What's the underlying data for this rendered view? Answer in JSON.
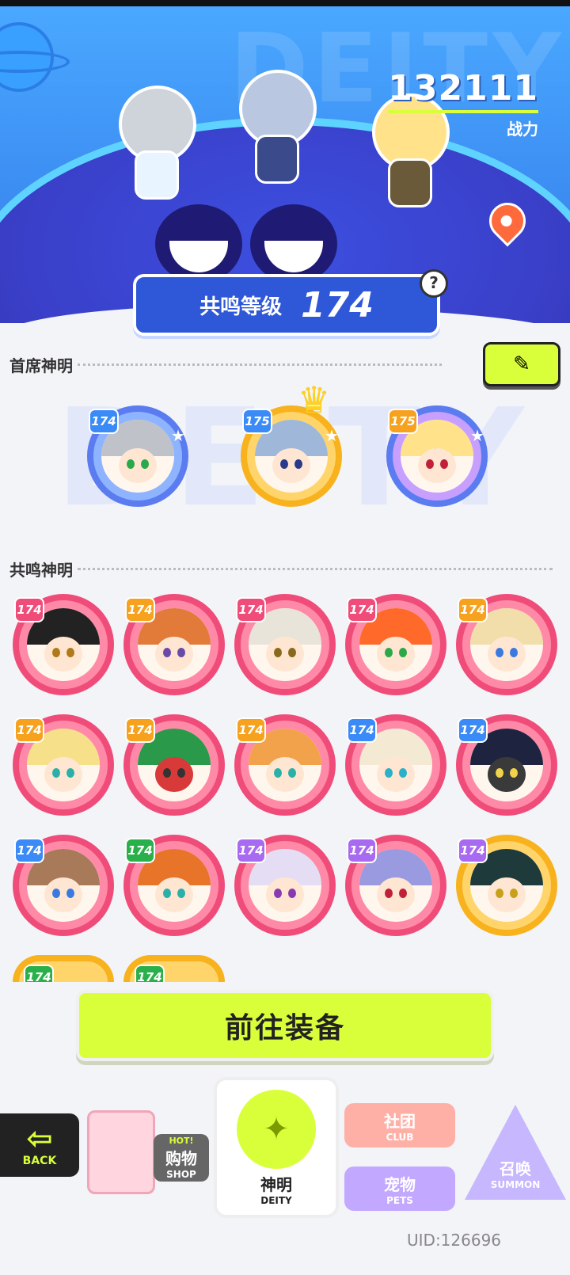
{
  "header": {
    "combat_power": "132111",
    "combat_power_label": "战力",
    "resonance_label": "共鸣等级",
    "resonance_level": "174",
    "help_icon": "?"
  },
  "sections": {
    "lead_title": "首席神明",
    "resonance_title": "共鸣神明"
  },
  "lead_deities": [
    {
      "level": "174",
      "frame": "purple"
    },
    {
      "level": "175",
      "frame": "gold"
    },
    {
      "level": "175",
      "frame": "purple"
    }
  ],
  "resonance_deities": [
    {
      "level": "174",
      "frame": "pink"
    },
    {
      "level": "174",
      "frame": "pink"
    },
    {
      "level": "174",
      "frame": "pink"
    },
    {
      "level": "174",
      "frame": "pink"
    },
    {
      "level": "174",
      "frame": "pink"
    },
    {
      "level": "174",
      "frame": "pink"
    },
    {
      "level": "174",
      "frame": "pink"
    },
    {
      "level": "174",
      "frame": "pink"
    },
    {
      "level": "174",
      "frame": "pink"
    },
    {
      "level": "174",
      "frame": "pink"
    },
    {
      "level": "174",
      "frame": "pink"
    },
    {
      "level": "174",
      "frame": "pink"
    },
    {
      "level": "174",
      "frame": "pink"
    },
    {
      "level": "174",
      "frame": "pink"
    },
    {
      "level": "174",
      "frame": "gold"
    },
    {
      "level": "174",
      "frame": "gold"
    },
    {
      "level": "174",
      "frame": "gold"
    }
  ],
  "equip_button": "前往装备",
  "nav": {
    "back_label": "BACK",
    "shop_cn": "购物",
    "shop_en": "SHOP",
    "shop_tag": "HOT!",
    "deity_cn": "神明",
    "deity_en": "DEITY",
    "club_cn": "社团",
    "club_en": "CLUB",
    "pets_cn": "宠物",
    "pets_en": "PETS",
    "summon_cn": "召唤",
    "summon_en": "SUMMON"
  },
  "uid": "UID:126696",
  "colors": {
    "accent": "#d9ff3a",
    "pink_frame": "#f04c7a",
    "gold_frame": "#f7b21e",
    "purple_frame": "#5b7cf0"
  }
}
